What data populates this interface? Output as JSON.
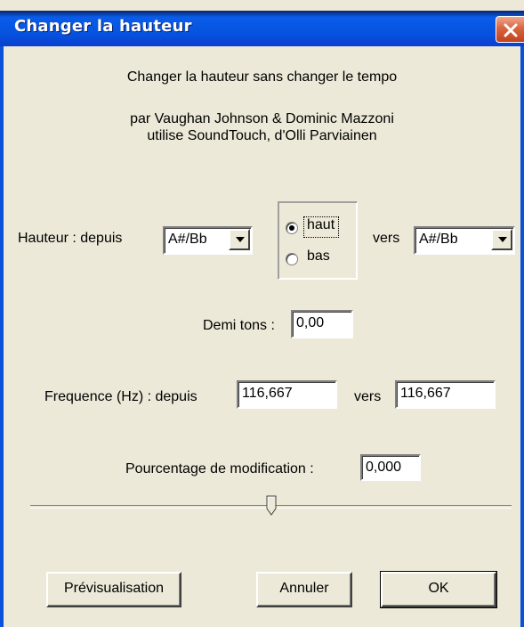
{
  "window": {
    "title": "Changer la hauteur"
  },
  "header": {
    "description": "Changer la hauteur sans changer le tempo",
    "credit_line1": "par Vaughan Johnson & Dominic Mazzoni",
    "credit_line2": "utilise SoundTouch, d'Olli Parviainen"
  },
  "pitch": {
    "label": "Hauteur : depuis",
    "from_value": "A#/Bb",
    "to_label": "vers",
    "to_value": "A#/Bb",
    "direction_options": [
      "haut",
      "bas"
    ],
    "direction_selected": "haut"
  },
  "semitones": {
    "label": "Demi tons :",
    "value": "0,00"
  },
  "frequency": {
    "label": "Frequence (Hz) : depuis",
    "from_value": "116,667",
    "to_label": "vers",
    "to_value": "116,667"
  },
  "percent": {
    "label": "Pourcentage de modification :",
    "value": "0,000",
    "slider_fraction": 0.5
  },
  "buttons": {
    "preview": "Prévisualisation",
    "cancel": "Annuler",
    "ok": "OK"
  },
  "colors": {
    "titlebar": "#0654e0",
    "close_button": "#d9653f",
    "dialog_bg": "#ece9d8"
  }
}
